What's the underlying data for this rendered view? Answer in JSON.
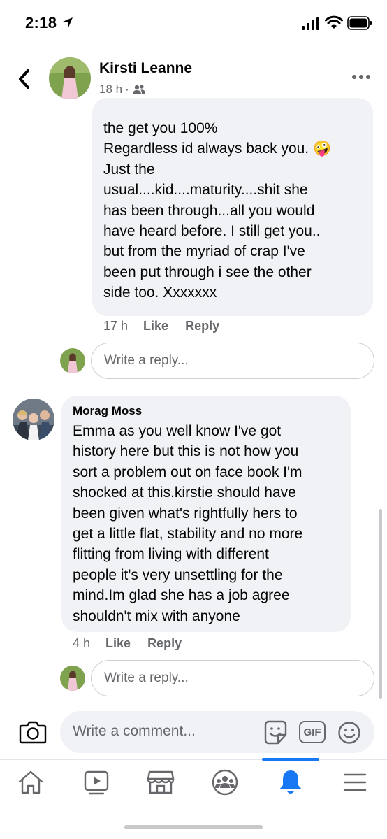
{
  "status_bar": {
    "time": "2:18"
  },
  "header": {
    "name": "Kirsti Leanne",
    "time_ago": "18 h",
    "separator": "·"
  },
  "comment_1": {
    "text": "the get you 100%\nRegardless id always back you. 🤪\nJust the\nusual....kid....maturity....shit she\nhas been through...all you would\nhave heard before. I still get you..\nbut from the myriad of crap I've\nbeen put through i see the other\nside too. Xxxxxxx",
    "time": "17 h",
    "like_label": "Like",
    "reply_label": "Reply"
  },
  "reply_box_1": {
    "placeholder": "Write a reply..."
  },
  "comment_2": {
    "author": "Morag Moss",
    "text": "Emma as you well know I've got\nhistory here but this is not how you\nsort a problem out on face book I'm\nshocked at this.kirstie should have\nbeen given what's rightfully hers to\nget a little flat, stability and no more\nflitting from living with different\npeople it's very unsettling  for the\nmind.Im glad she has a job agree\nshouldn't mix with anyone",
    "time": "4 h",
    "like_label": "Like",
    "reply_label": "Reply"
  },
  "reply_box_2": {
    "placeholder": "Write a reply..."
  },
  "composer": {
    "placeholder": "Write a comment...",
    "gif_label": "GIF"
  },
  "bottom_nav": {
    "items": [
      "home",
      "watch",
      "marketplace",
      "groups",
      "notifications",
      "menu"
    ],
    "active": "notifications"
  },
  "colors": {
    "accent": "#1877f2",
    "bubble": "#f0f2f5",
    "secondary_text": "#65676b"
  }
}
